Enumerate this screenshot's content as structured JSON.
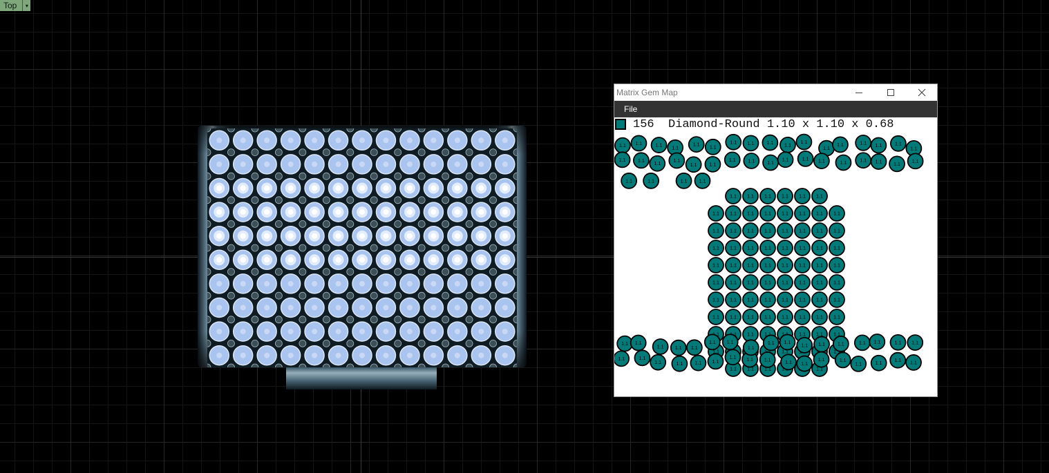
{
  "viewport": {
    "label": "Top",
    "dropdown_icon": "triangle-down-icon"
  },
  "gem_window": {
    "title": "Matrix Gem Map",
    "controls": [
      "minimize-icon",
      "maximize-icon",
      "close-icon"
    ],
    "menu": {
      "file": "File"
    },
    "gem_info": {
      "count": "156",
      "spec": "Diamond-Round 1.10 x 1.10 x 0.68",
      "color": "#007a78"
    },
    "gem_label": "1.1"
  },
  "colors": {
    "gem_fill": "#007a78",
    "model_gem": "#aac4f0",
    "model_bead": "#3c4f57",
    "window_menu": "#333333"
  }
}
